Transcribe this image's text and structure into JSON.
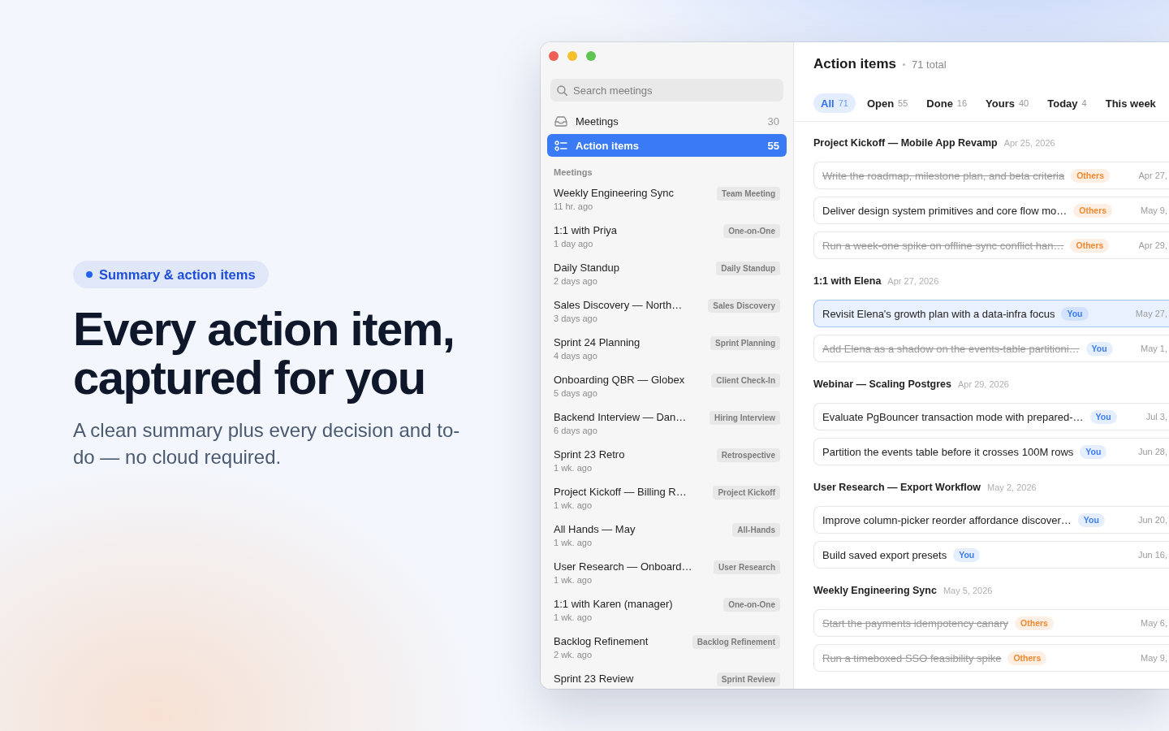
{
  "hero": {
    "badge": "Summary & action items",
    "headline": "Every action item, captured for you",
    "subtitle": "A clean summary plus every decision and to-do — no cloud required."
  },
  "sidebar": {
    "search": {
      "placeholder": "Search meetings"
    },
    "nav": [
      {
        "label": "Meetings",
        "count": "30",
        "selected": false
      },
      {
        "label": "Action items",
        "count": "55",
        "selected": true
      }
    ],
    "section_title": "Meetings",
    "meetings": [
      {
        "title": "Weekly Engineering Sync",
        "time": "11 hr. ago",
        "tag": "Team Meeting"
      },
      {
        "title": "1:1 with Priya",
        "time": "1 day ago",
        "tag": "One-on-One"
      },
      {
        "title": "Daily Standup",
        "time": "2 days ago",
        "tag": "Daily Standup"
      },
      {
        "title": "Sales Discovery — North…",
        "time": "3 days ago",
        "tag": "Sales Discovery"
      },
      {
        "title": "Sprint 24 Planning",
        "time": "4 days ago",
        "tag": "Sprint Planning"
      },
      {
        "title": "Onboarding QBR — Globex",
        "time": "5 days ago",
        "tag": "Client Check-In"
      },
      {
        "title": "Backend Interview — Dan…",
        "time": "6 days ago",
        "tag": "Hiring Interview"
      },
      {
        "title": "Sprint 23 Retro",
        "time": "1 wk. ago",
        "tag": "Retrospective"
      },
      {
        "title": "Project Kickoff — Billing R…",
        "time": "1 wk. ago",
        "tag": "Project Kickoff"
      },
      {
        "title": "All Hands — May",
        "time": "1 wk. ago",
        "tag": "All-Hands"
      },
      {
        "title": "User Research — Onboard…",
        "time": "1 wk. ago",
        "tag": "User Research"
      },
      {
        "title": "1:1 with Karen (manager)",
        "time": "1 wk. ago",
        "tag": "One-on-One"
      },
      {
        "title": "Backlog Refinement",
        "time": "2 wk. ago",
        "tag": "Backlog Refinement"
      },
      {
        "title": "Sprint 23 Review",
        "tag": "Sprint Review"
      }
    ]
  },
  "main": {
    "title": "Action items",
    "total": "71 total",
    "tabs": [
      {
        "label": "All",
        "count": "71",
        "selected": true
      },
      {
        "label": "Open",
        "count": "55",
        "selected": false
      },
      {
        "label": "Done",
        "count": "16",
        "selected": false
      },
      {
        "label": "Yours",
        "count": "40",
        "selected": false
      },
      {
        "label": "Today",
        "count": "4",
        "selected": false
      },
      {
        "label": "This week",
        "selected": false
      }
    ],
    "groups": [
      {
        "meeting": "Project Kickoff — Mobile App Revamp",
        "date": "Apr 25, 2026",
        "items": [
          {
            "text": "Write the roadmap, milestone plan, and beta criteria",
            "done": true,
            "selected": false,
            "owner": {
              "label": "Others",
              "color": "#f0892f"
            },
            "due": "Apr 27,"
          },
          {
            "text": "Deliver design system primitives and core flow mo…",
            "done": false,
            "selected": false,
            "owner": {
              "label": "Others",
              "color": "#f0892f"
            },
            "due": "May 9,"
          },
          {
            "text": "Run a week-one spike on offline sync conflict han…",
            "done": true,
            "selected": false,
            "owner": {
              "label": "Others",
              "color": "#f0892f"
            },
            "due": "Apr 29,"
          }
        ]
      },
      {
        "meeting": "1:1 with Elena",
        "date": "Apr 27, 2026",
        "items": [
          {
            "text": "Revisit Elena's growth plan with a data-infra focus",
            "done": false,
            "selected": true,
            "owner": {
              "label": "You",
              "color": "#3b7cf0"
            },
            "due": "May 27,"
          },
          {
            "text": "Add Elena as a shadow on the events-table partitioni…",
            "done": true,
            "selected": false,
            "owner": {
              "label": "You",
              "color": "#3b7cf0"
            },
            "due": "May 1,"
          }
        ]
      },
      {
        "meeting": "Webinar — Scaling Postgres",
        "date": "Apr 29, 2026",
        "items": [
          {
            "text": "Evaluate PgBouncer transaction mode with prepared-…",
            "done": false,
            "selected": false,
            "owner": {
              "label": "You",
              "color": "#3b7cf0"
            },
            "due": "Jul 3,"
          },
          {
            "text": "Partition the events table before it crosses 100M rows",
            "done": false,
            "selected": false,
            "owner": {
              "label": "You",
              "color": "#3b7cf0"
            },
            "due": "Jun 28,"
          }
        ]
      },
      {
        "meeting": "User Research — Export Workflow",
        "date": "May 2, 2026",
        "items": [
          {
            "text": "Improve column-picker reorder affordance discover…",
            "done": false,
            "selected": false,
            "owner": {
              "label": "You",
              "color": "#3b7cf0"
            },
            "due": "Jun 20,"
          },
          {
            "text": "Build saved export presets",
            "done": false,
            "selected": false,
            "owner": {
              "label": "You",
              "color": "#3b7cf0"
            },
            "due": "Jun 16,"
          }
        ]
      },
      {
        "meeting": "Weekly Engineering Sync",
        "date": "May 5, 2026",
        "items": [
          {
            "text": "Start the payments idempotency canary",
            "done": true,
            "selected": false,
            "owner": {
              "label": "Others",
              "color": "#f0892f"
            },
            "due": "May 6,"
          },
          {
            "text": "Run a timeboxed SSO feasibility spike",
            "done": true,
            "selected": false,
            "owner": {
              "label": "Others",
              "color": "#f0892f"
            },
            "due": "May 9,"
          }
        ]
      }
    ]
  }
}
